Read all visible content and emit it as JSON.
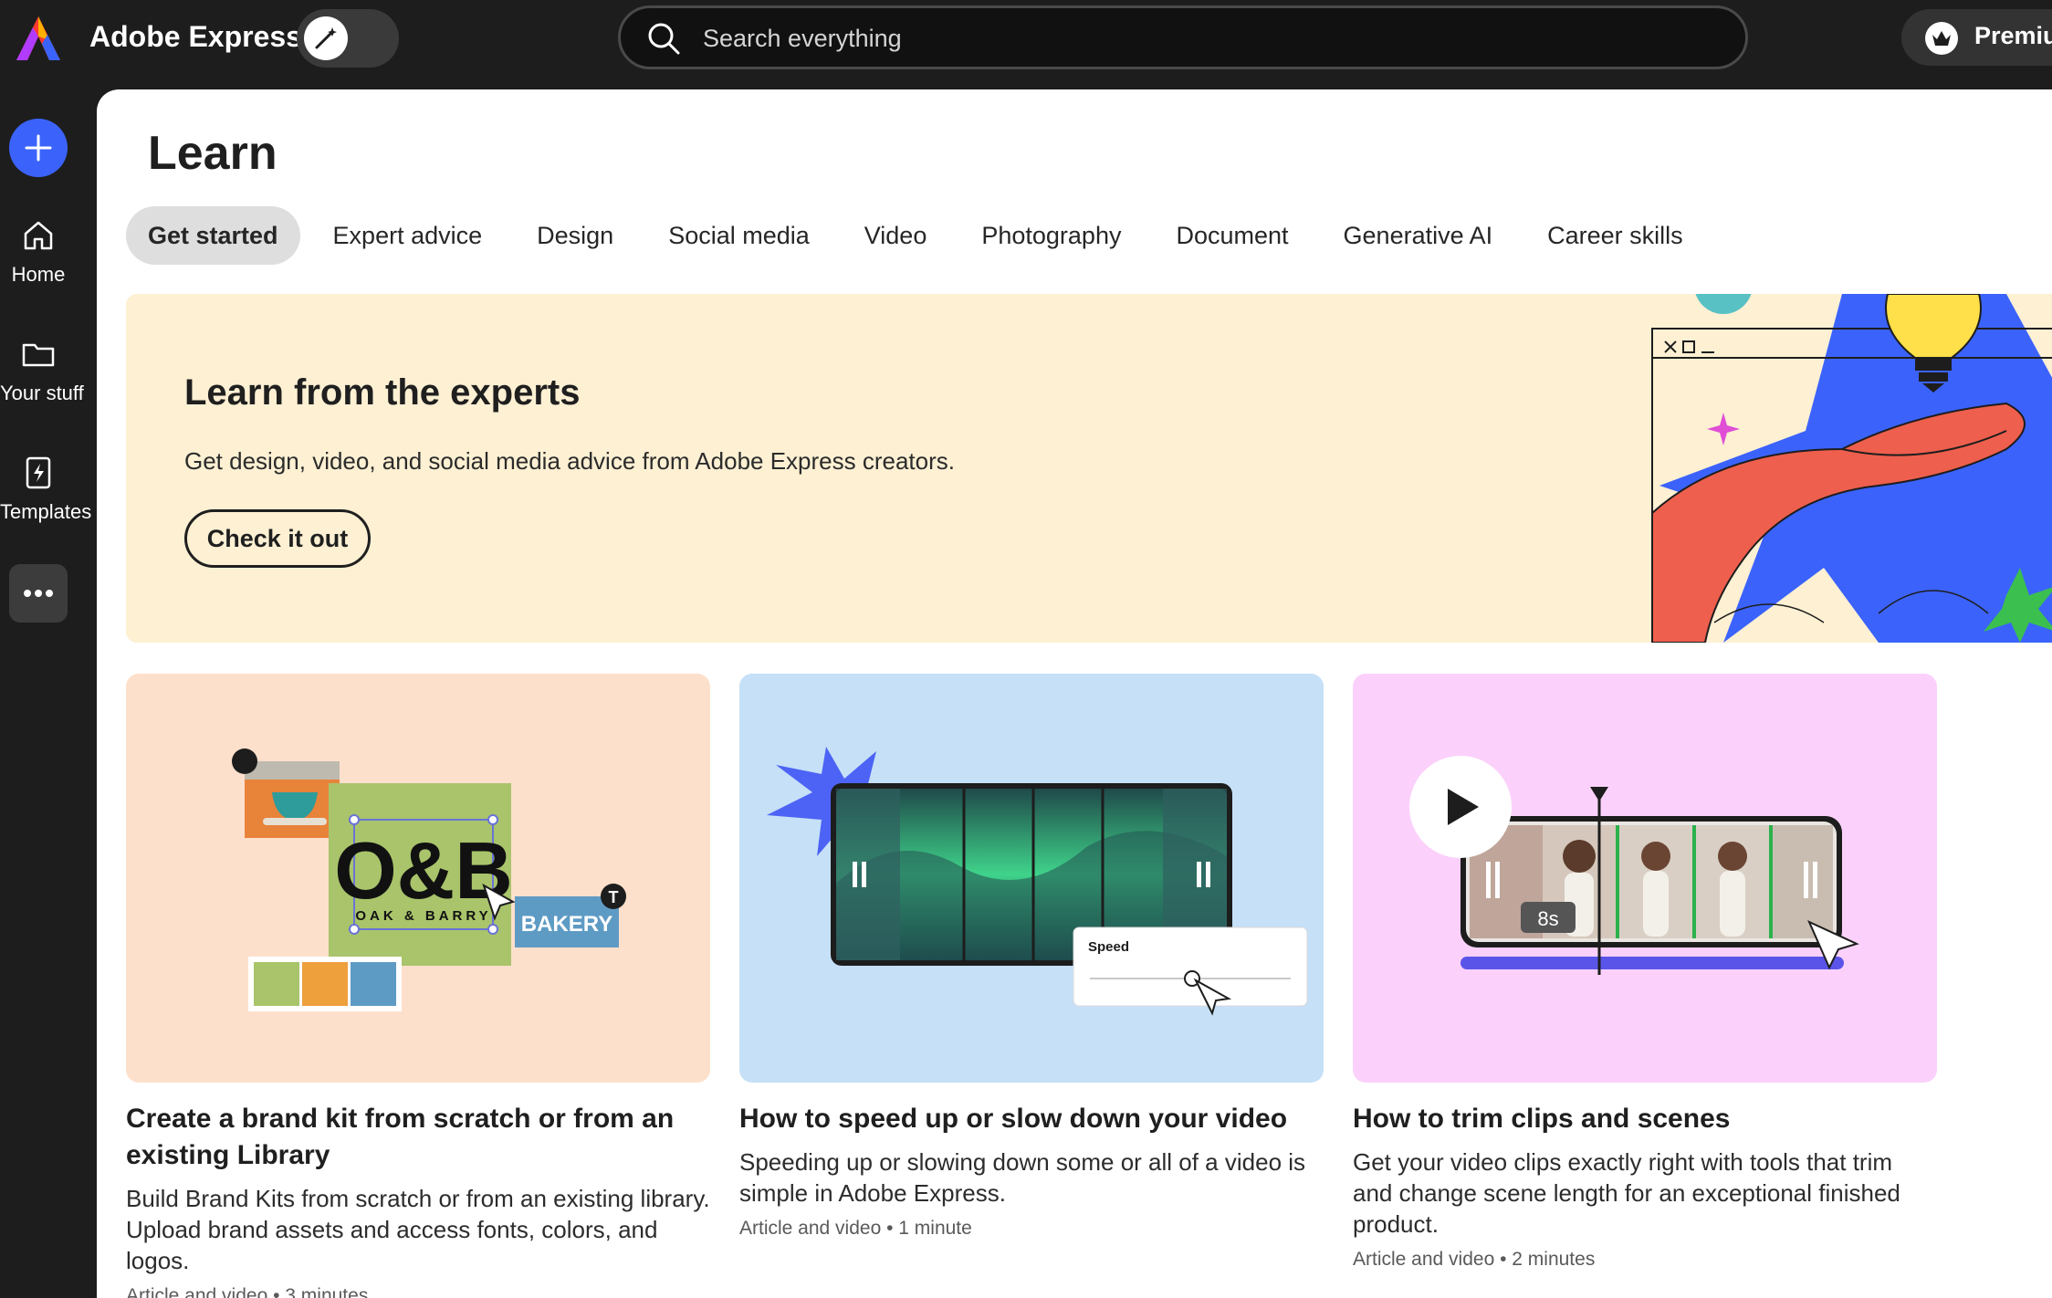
{
  "app": {
    "name": "Adobe Express"
  },
  "search": {
    "placeholder": "Search everything"
  },
  "premium": {
    "label": "Premium"
  },
  "nav": {
    "items": [
      {
        "label": "Home",
        "icon": "home-icon"
      },
      {
        "label": "Your stuff",
        "icon": "folder-icon"
      },
      {
        "label": "Templates",
        "icon": "templates-icon"
      }
    ]
  },
  "page": {
    "title": "Learn"
  },
  "tabs": [
    {
      "label": "Get started",
      "active": true
    },
    {
      "label": "Expert advice"
    },
    {
      "label": "Design"
    },
    {
      "label": "Social media"
    },
    {
      "label": "Video"
    },
    {
      "label": "Photography"
    },
    {
      "label": "Document"
    },
    {
      "label": "Generative AI"
    },
    {
      "label": "Career skills"
    }
  ],
  "hero": {
    "title": "Learn from the experts",
    "subtitle": "Get design, video, and social media advice from Adobe Express creators.",
    "cta": "Check it out"
  },
  "cards": [
    {
      "title": "Create a brand kit from scratch or from an existing Library",
      "description": "Build Brand Kits from scratch or from an existing library. Upload brand assets and access fonts, colors, and logos.",
      "meta": "Article and video • 3 minutes",
      "thumb": {
        "logo_text": "O&B",
        "logo_sub": "OAK & BARRY",
        "tag": "BAKERY"
      }
    },
    {
      "title": "How to speed up or slow down your video",
      "description": "Speeding up or slowing down some or all of a video is simple in Adobe Express.",
      "meta": "Article and video • 1 minute",
      "thumb": {
        "panel_label": "Speed"
      }
    },
    {
      "title": "How to trim clips and scenes",
      "description": "Get your video clips exactly right with tools that trim and change scene length for an exceptional finished product.",
      "meta": "Article and video • 2 minutes",
      "thumb": {
        "duration": "8s"
      }
    }
  ],
  "colors": {
    "accent": "#3b63fb",
    "hero_bg": "#fdf0d3",
    "card1_bg": "#fde0cc",
    "card2_bg": "#c5e0f7",
    "card3_bg": "#fbd1fb"
  }
}
